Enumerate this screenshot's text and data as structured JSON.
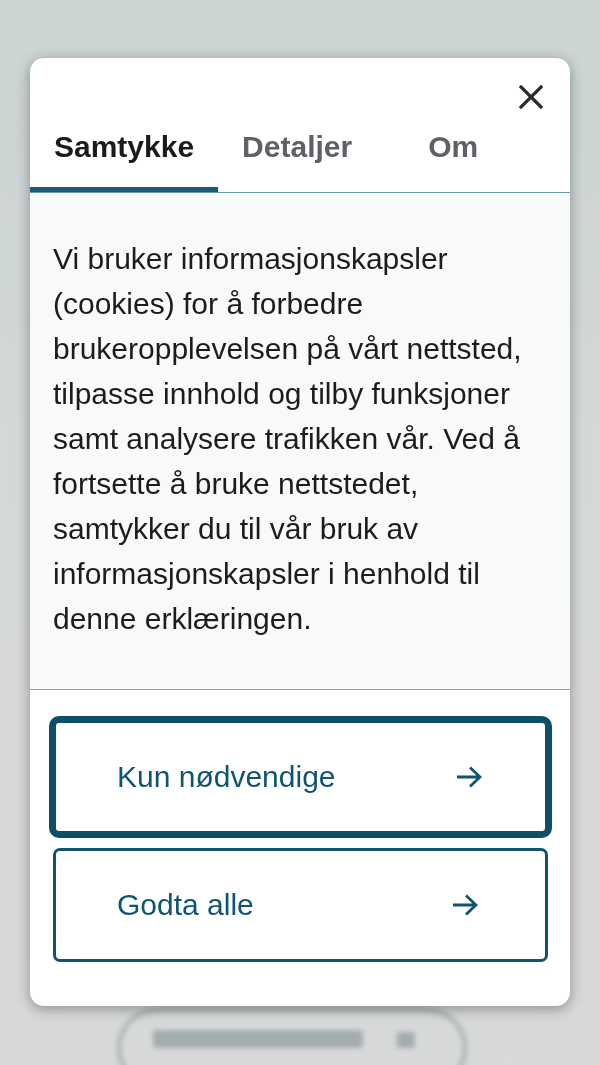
{
  "tabs": [
    {
      "label": "Samtykke",
      "selected": true
    },
    {
      "label": "Detaljer",
      "selected": false
    },
    {
      "label": "Om",
      "selected": false
    }
  ],
  "message": "Vi bruker informasjonskapsler (cookies) for å forbedre brukeropplevelsen på vårt nettsted, tilpasse innhold og tilby funksjoner samt analysere trafikken vår. Ved å fortsette å bruke nettstedet,\nsamtykker du til vår bruk av informasjonskapsler i henhold til denne erklæringen.",
  "buttons": [
    {
      "label": "Kun nødvendige",
      "focused": true
    },
    {
      "label": "Godta alle",
      "focused": false
    }
  ]
}
